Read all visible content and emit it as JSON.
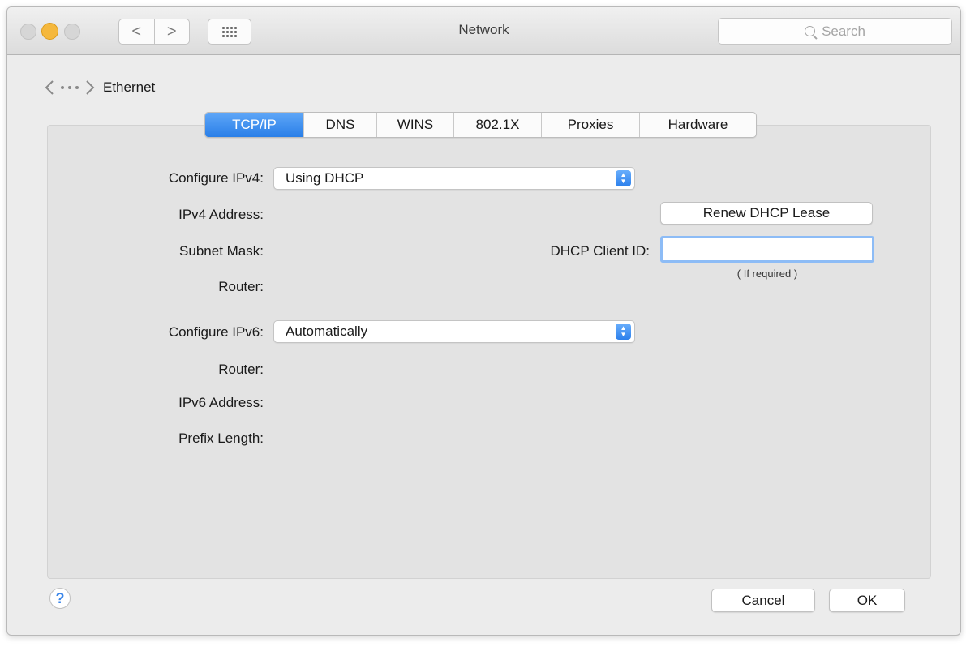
{
  "window": {
    "title": "Network",
    "search_placeholder": "Search"
  },
  "toolbar": {
    "back_glyph": "<",
    "forward_glyph": ">"
  },
  "service": {
    "name": "Ethernet",
    "icon": "ethernet-icon"
  },
  "tabs": [
    {
      "label": "TCP/IP",
      "active": true
    },
    {
      "label": "DNS",
      "active": false
    },
    {
      "label": "WINS",
      "active": false
    },
    {
      "label": "802.1X",
      "active": false
    },
    {
      "label": "Proxies",
      "active": false
    },
    {
      "label": "Hardware",
      "active": false
    }
  ],
  "ipv4": {
    "configure_label": "Configure IPv4:",
    "configure_value": "Using DHCP",
    "address_label": "IPv4 Address:",
    "subnet_label": "Subnet Mask:",
    "router_label": "Router:",
    "renew_button": "Renew DHCP Lease",
    "client_id_label": "DHCP Client ID:",
    "client_id_value": "",
    "client_id_hint": "( If required )"
  },
  "ipv6": {
    "configure_label": "Configure IPv6:",
    "configure_value": "Automatically",
    "router_label": "Router:",
    "address_label": "IPv6 Address:",
    "prefix_label": "Prefix Length:"
  },
  "footer": {
    "help_label": "?",
    "cancel_label": "Cancel",
    "ok_label": "OK"
  },
  "colors": {
    "accent": "#2a7fe8",
    "minimize": "#f5b83d"
  }
}
